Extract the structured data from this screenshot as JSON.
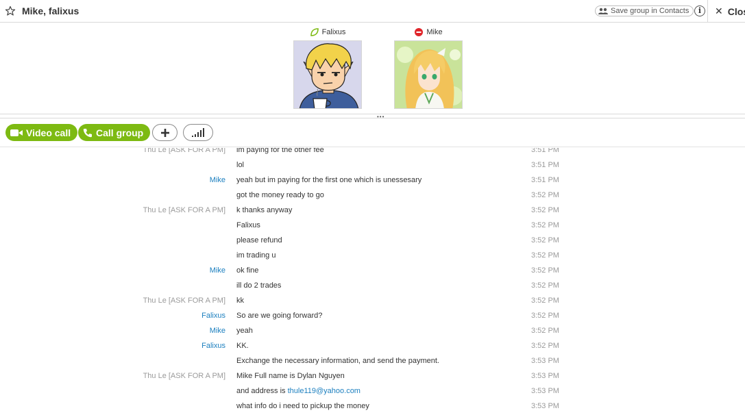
{
  "header": {
    "title": "Mike, falixus",
    "save_label": "Save group in Contacts",
    "info_label": "i",
    "close_label": "Close"
  },
  "participants": [
    {
      "name": "Falixus",
      "status": "online",
      "status_color": "#7dba12"
    },
    {
      "name": "Mike",
      "status": "do-not-disturb",
      "status_color": "#e0252a"
    }
  ],
  "toolbar": {
    "video_call_label": "Video call",
    "call_group_label": "Call group",
    "add_icon": "plus-icon",
    "quality_icon": "signal-bars-icon",
    "accent_color": "#7dba12"
  },
  "messages": [
    {
      "sender": "Thu Le [ASK FOR A PM]",
      "sender_style": "gray",
      "text": "im paying for the other fee",
      "time": "3:51 PM"
    },
    {
      "sender": "",
      "sender_style": "gray",
      "text": "lol",
      "time": "3:51 PM"
    },
    {
      "sender": "Mike",
      "sender_style": "blue",
      "text": "yeah but im paying for the first one which is unessesary",
      "time": "3:51 PM"
    },
    {
      "sender": "",
      "sender_style": "gray",
      "text": "got the money ready to go",
      "time": "3:52 PM"
    },
    {
      "sender": "Thu Le [ASK FOR A PM]",
      "sender_style": "gray",
      "text": "k thanks anyway",
      "time": "3:52 PM"
    },
    {
      "sender": "",
      "sender_style": "gray",
      "text": "Falixus",
      "time": "3:52 PM"
    },
    {
      "sender": "",
      "sender_style": "gray",
      "text": "please refund",
      "time": "3:52 PM"
    },
    {
      "sender": "",
      "sender_style": "gray",
      "text": "im trading u",
      "time": "3:52 PM"
    },
    {
      "sender": "Mike",
      "sender_style": "blue",
      "text": "ok fine",
      "time": "3:52 PM"
    },
    {
      "sender": "",
      "sender_style": "gray",
      "text": "ill do 2 trades",
      "time": "3:52 PM"
    },
    {
      "sender": "Thu Le [ASK FOR A PM]",
      "sender_style": "gray",
      "text": "kk",
      "time": "3:52 PM"
    },
    {
      "sender": "Falixus",
      "sender_style": "blue",
      "text": "So are we going forward?",
      "time": "3:52 PM"
    },
    {
      "sender": "Mike",
      "sender_style": "blue",
      "text": "yeah",
      "time": "3:52 PM"
    },
    {
      "sender": "Falixus",
      "sender_style": "blue",
      "text": "KK.",
      "time": "3:52 PM"
    },
    {
      "sender": "",
      "sender_style": "gray",
      "text": "Exchange the necessary information, and send the payment.",
      "time": "3:53 PM"
    },
    {
      "sender": "Thu Le [ASK FOR A PM]",
      "sender_style": "gray",
      "text": "Mike Full name is Dylan Nguyen",
      "time": "3:53 PM"
    },
    {
      "sender": "",
      "sender_style": "gray",
      "text": "and address is ",
      "link": "thule119@yahoo.com",
      "time": "3:53 PM"
    },
    {
      "sender": "",
      "sender_style": "gray",
      "text": "what info do i need to pickup the money",
      "time": "3:53 PM"
    }
  ]
}
